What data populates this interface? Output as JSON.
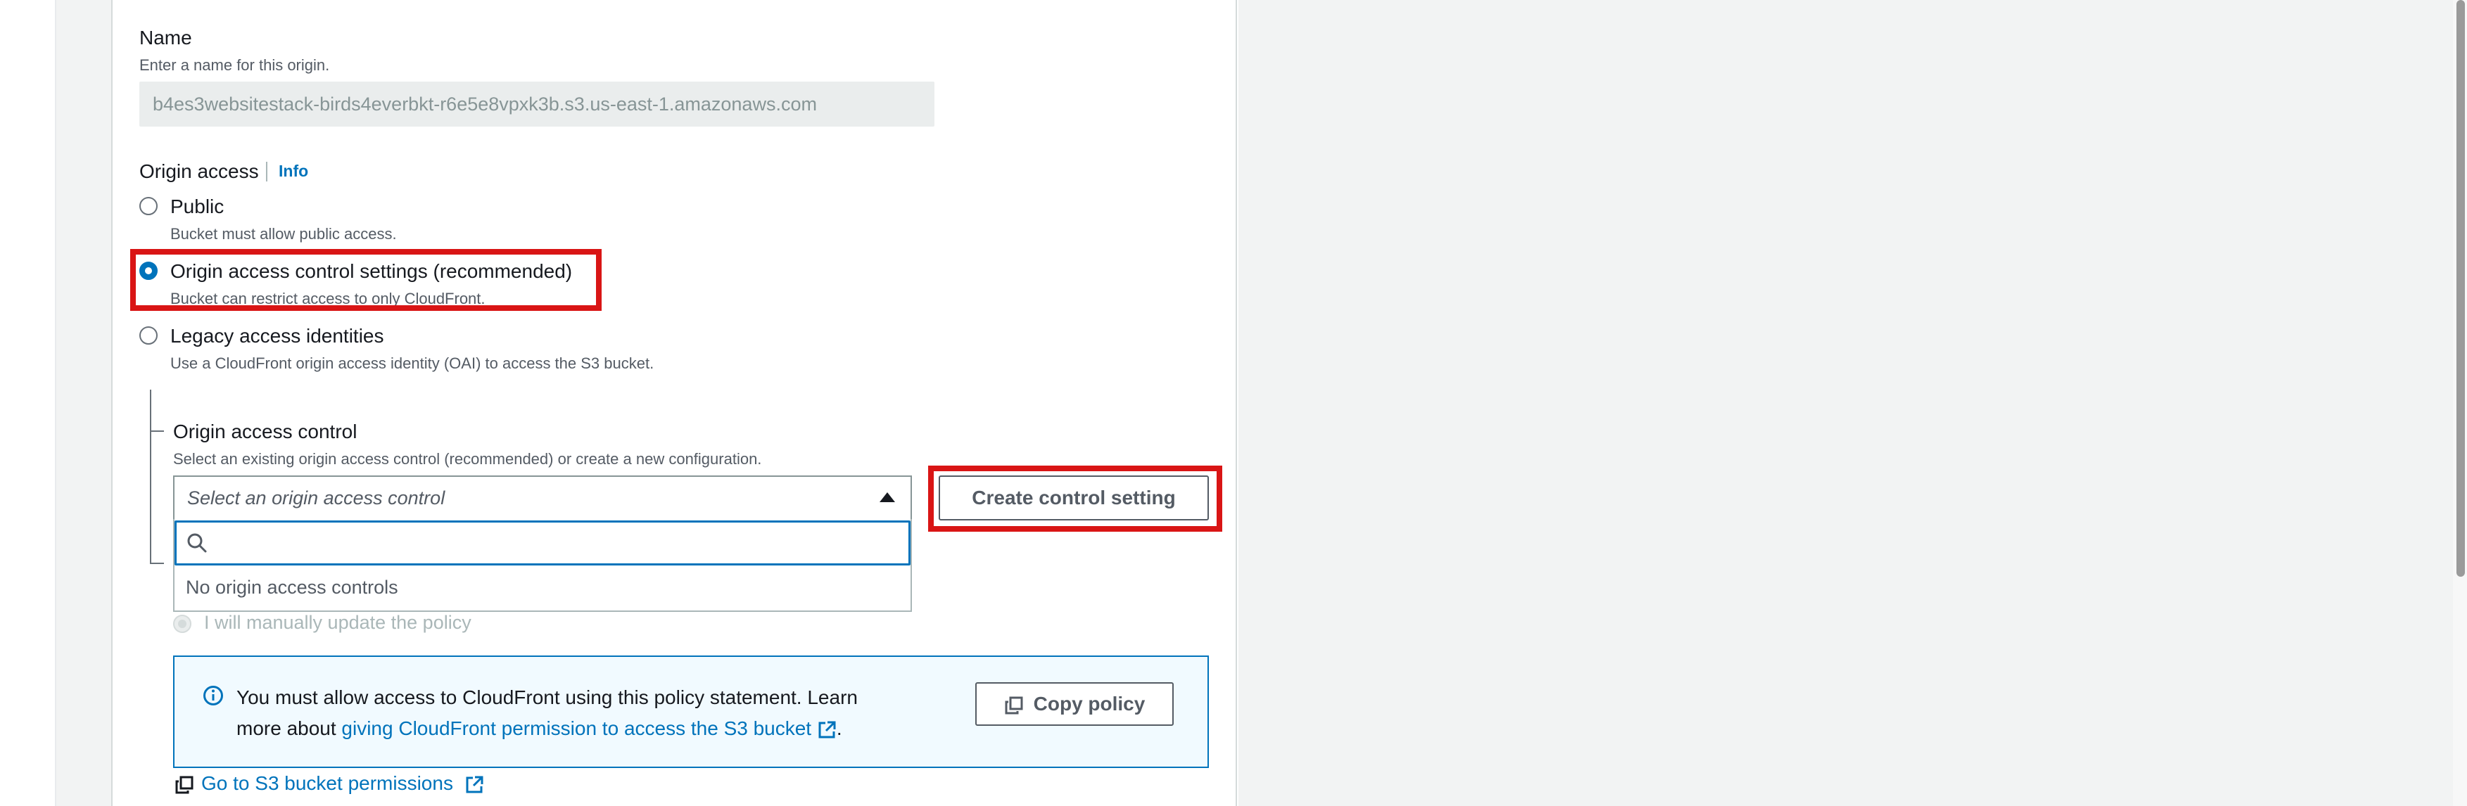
{
  "name_field": {
    "label": "Name",
    "description": "Enter a name for this origin.",
    "value": "b4es3websitestack-birds4everbkt-r6e5e8vpxk3b.s3.us-east-1.amazonaws.com"
  },
  "origin_access": {
    "label": "Origin access",
    "info_link": "Info",
    "options": [
      {
        "label": "Public",
        "description": "Bucket must allow public access.",
        "selected": false
      },
      {
        "label": "Origin access control settings (recommended)",
        "description": "Bucket can restrict access to only CloudFront.",
        "selected": true
      },
      {
        "label": "Legacy access identities",
        "description": "Use a CloudFront origin access identity (OAI) to access the S3 bucket.",
        "selected": false
      }
    ]
  },
  "origin_access_control": {
    "label": "Origin access control",
    "description": "Select an existing origin access control (recommended) or create a new configuration.",
    "placeholder": "Select an origin access control",
    "create_button": "Create control setting",
    "search_value": "",
    "empty_message": "No origin access controls"
  },
  "bucket_policy": {
    "manual_option": "I will manually update the policy"
  },
  "alert": {
    "text_before": "You must allow access to CloudFront using this policy statement. Learn more about ",
    "link_text": "giving CloudFront permission to access the S3 bucket",
    "text_after": ".",
    "copy_button": "Copy policy"
  },
  "s3_permissions_link": "Go to S3 bucket permissions",
  "colors": {
    "link": "#0073bb",
    "highlight": "#d91515",
    "alert_bg": "#f1faff"
  },
  "icons": [
    "search-icon",
    "info-icon",
    "external-link-icon",
    "copy-icon",
    "caret-up-icon"
  ]
}
